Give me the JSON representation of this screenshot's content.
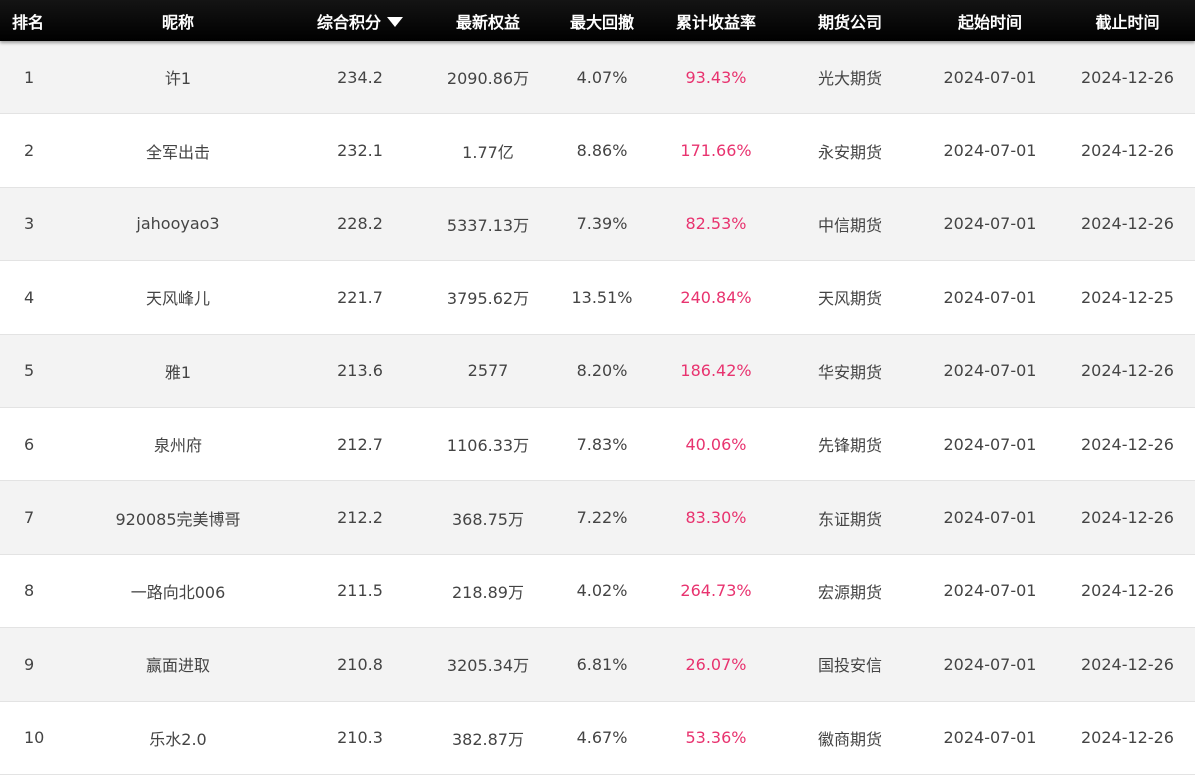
{
  "header": {
    "rank": "排名",
    "nickname": "昵称",
    "score": "综合积分",
    "equity": "最新权益",
    "drawdown": "最大回撤",
    "return": "累计收益率",
    "company": "期货公司",
    "start": "起始时间",
    "end": "截止时间",
    "sort_icon": "caret-down-icon"
  },
  "colors": {
    "header_bg": "#000000",
    "row_alt": "#f3f3f3",
    "return_red": "#e8336f",
    "text": "#444444"
  },
  "rows": [
    {
      "rank": "1",
      "nickname": "许1",
      "score": "234.2",
      "equity": "2090.86万",
      "drawdown": "4.07%",
      "return": "93.43%",
      "company": "光大期货",
      "start": "2024-07-01",
      "end": "2024-12-26"
    },
    {
      "rank": "2",
      "nickname": "全军出击",
      "score": "232.1",
      "equity": "1.77亿",
      "drawdown": "8.86%",
      "return": "171.66%",
      "company": "永安期货",
      "start": "2024-07-01",
      "end": "2024-12-26"
    },
    {
      "rank": "3",
      "nickname": "jahooyao3",
      "score": "228.2",
      "equity": "5337.13万",
      "drawdown": "7.39%",
      "return": "82.53%",
      "company": "中信期货",
      "start": "2024-07-01",
      "end": "2024-12-26"
    },
    {
      "rank": "4",
      "nickname": "天风峰儿",
      "score": "221.7",
      "equity": "3795.62万",
      "drawdown": "13.51%",
      "return": "240.84%",
      "company": "天风期货",
      "start": "2024-07-01",
      "end": "2024-12-25"
    },
    {
      "rank": "5",
      "nickname": "雅1",
      "score": "213.6",
      "equity": "2577",
      "drawdown": "8.20%",
      "return": "186.42%",
      "company": "华安期货",
      "start": "2024-07-01",
      "end": "2024-12-26"
    },
    {
      "rank": "6",
      "nickname": "泉州府",
      "score": "212.7",
      "equity": "1106.33万",
      "drawdown": "7.83%",
      "return": "40.06%",
      "company": "先锋期货",
      "start": "2024-07-01",
      "end": "2024-12-26"
    },
    {
      "rank": "7",
      "nickname": "920085完美博哥",
      "score": "212.2",
      "equity": "368.75万",
      "drawdown": "7.22%",
      "return": "83.30%",
      "company": "东证期货",
      "start": "2024-07-01",
      "end": "2024-12-26"
    },
    {
      "rank": "8",
      "nickname": "一路向北006",
      "score": "211.5",
      "equity": "218.89万",
      "drawdown": "4.02%",
      "return": "264.73%",
      "company": "宏源期货",
      "start": "2024-07-01",
      "end": "2024-12-26"
    },
    {
      "rank": "9",
      "nickname": "赢面进取",
      "score": "210.8",
      "equity": "3205.34万",
      "drawdown": "6.81%",
      "return": "26.07%",
      "company": "国投安信",
      "start": "2024-07-01",
      "end": "2024-12-26"
    },
    {
      "rank": "10",
      "nickname": "乐水2.0",
      "score": "210.3",
      "equity": "382.87万",
      "drawdown": "4.67%",
      "return": "53.36%",
      "company": "徽商期货",
      "start": "2024-07-01",
      "end": "2024-12-26"
    }
  ]
}
